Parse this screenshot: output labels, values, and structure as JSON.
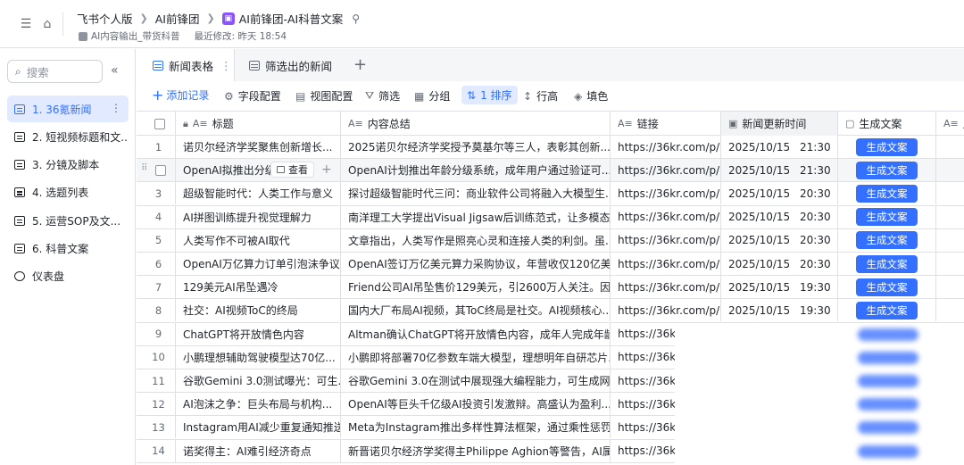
{
  "header": {
    "breadcrumbs": [
      "飞书个人版",
      "AI前锋团",
      "AI前锋团-AI科普文案"
    ],
    "subtitle_tag": "AI内容输出_带货科普",
    "last_modified": "最近修改: 昨天 18:54"
  },
  "sidebar": {
    "search_placeholder": "搜索",
    "items": [
      {
        "label": "1. 36氪新闻"
      },
      {
        "label": "2. 短视频标题和文..."
      },
      {
        "label": "3. 分镜及脚本"
      },
      {
        "label": "4. 选题列表"
      },
      {
        "label": "5. 运营SOP及文..."
      },
      {
        "label": "6. 科普文案"
      },
      {
        "label": "仪表盘"
      }
    ]
  },
  "tabs": [
    {
      "label": "新闻表格"
    },
    {
      "label": "筛选出的新闻"
    }
  ],
  "toolbar": {
    "add_record": "添加记录",
    "field_config": "字段配置",
    "view_config": "视图配置",
    "filter": "筛选",
    "group": "分组",
    "sort": "1 排序",
    "row_height": "行高",
    "fill": "填色"
  },
  "columns": {
    "title": "标题",
    "summary": "内容总结",
    "link": "链接",
    "updated": "新闻更新时间",
    "generate": "生成文案",
    "extra": "用"
  },
  "row_hover": {
    "view_label": "查看"
  },
  "rows": [
    {
      "num": "1",
      "title": "诺贝尔经济学奖聚焦创新增长...",
      "summary": "2025诺贝尔经济学奖授予莫基尔等三人，表彰其创新...",
      "link": "https://36kr.com/p/...",
      "date": "2025/10/15",
      "time": "21:30",
      "action": "生成文案"
    },
    {
      "num": "",
      "title": "OpenAI拟推出分级系统",
      "summary": "OpenAI计划推出年龄分级系统，成年用户通过验证可...",
      "link": "https://36kr.com/p/...",
      "date": "2025/10/15",
      "time": "21:30",
      "action": "生成文案"
    },
    {
      "num": "3",
      "title": "超级智能时代：人类工作与意义",
      "summary": "探讨超级智能时代三问：商业软件公司将融入大模型生...",
      "link": "https://36kr.com/p/...",
      "date": "2025/10/15",
      "time": "20:30",
      "action": "生成文案"
    },
    {
      "num": "4",
      "title": "AI拼图训练提升视觉理解力",
      "summary": "南洋理工大学提出Visual Jigsaw后训练范式，让多模态...",
      "link": "https://36kr.com/p/...",
      "date": "2025/10/15",
      "time": "20:30",
      "action": "生成文案"
    },
    {
      "num": "5",
      "title": "人类写作不可被AI取代",
      "summary": "文章指出，人类写作是照亮心灵和连接人类的利剑。虽...",
      "link": "https://36kr.com/p/...",
      "date": "2025/10/15",
      "time": "20:30",
      "action": "生成文案"
    },
    {
      "num": "6",
      "title": "OpenAI万亿算力订单引泡沫争议",
      "summary": "OpenAI签订万亿美元算力采购协议，年营收仅120亿美...",
      "link": "https://36kr.com/p/...",
      "date": "2025/10/15",
      "time": "20:30",
      "action": "生成文案"
    },
    {
      "num": "7",
      "title": "129美元AI吊坠遇冷",
      "summary": "Friend公司AI吊坠售价129美元，引2600万人关注。因...",
      "link": "https://36kr.com/p/...",
      "date": "2025/10/15",
      "time": "19:30",
      "action": "生成文案"
    },
    {
      "num": "8",
      "title": "社交：AI视频ToC的终局",
      "summary": "国内大厂布局AI视频，其ToC终局是社交。AI视频核心...",
      "link": "https://36kr.com/p/...",
      "date": "2025/10/15",
      "time": "19:30",
      "action": "生成文案"
    },
    {
      "num": "9",
      "title": "ChatGPT将开放情色内容",
      "summary": "Altman确认ChatGPT将开放情色内容，成年人完成年龄...",
      "link": "https://36kr",
      "date": "",
      "time": "",
      "action": ""
    },
    {
      "num": "10",
      "title": "小鹏理想辅助驾驶模型达70亿...",
      "summary": "小鹏即将部署70亿参数车端大模型，理想明年自研芯片...",
      "link": "https://36kr",
      "date": "",
      "time": "",
      "action": ""
    },
    {
      "num": "11",
      "title": "谷歌Gemini 3.0测试曝光：可生...",
      "summary": "谷歌Gemini 3.0在测试中展现强大编程能力，可生成网...",
      "link": "https://36kr",
      "date": "",
      "time": "",
      "action": ""
    },
    {
      "num": "12",
      "title": "AI泡沫之争：巨头布局与机构...",
      "summary": "OpenAI等巨头千亿级AI投资引发激辩。高盛认为盈利...",
      "link": "https://36kr",
      "date": "",
      "time": "",
      "action": ""
    },
    {
      "num": "13",
      "title": "Instagram用AI减少重复通知推送",
      "summary": "Meta为Instagram推出多样性算法框架，通过乘性惩罚...",
      "link": "https://36kr",
      "date": "",
      "time": "",
      "action": ""
    },
    {
      "num": "14",
      "title": "诺奖得主：AI难引经济奇点",
      "summary": "新晋诺贝尔经济学奖得主Philippe Aghion等警告，AI属...",
      "link": "https://36kr",
      "date": "",
      "time": "",
      "action": ""
    }
  ],
  "colors": {
    "accent": "#3370ff",
    "active_bg": "#e1eaff",
    "border": "#dee0e3"
  }
}
